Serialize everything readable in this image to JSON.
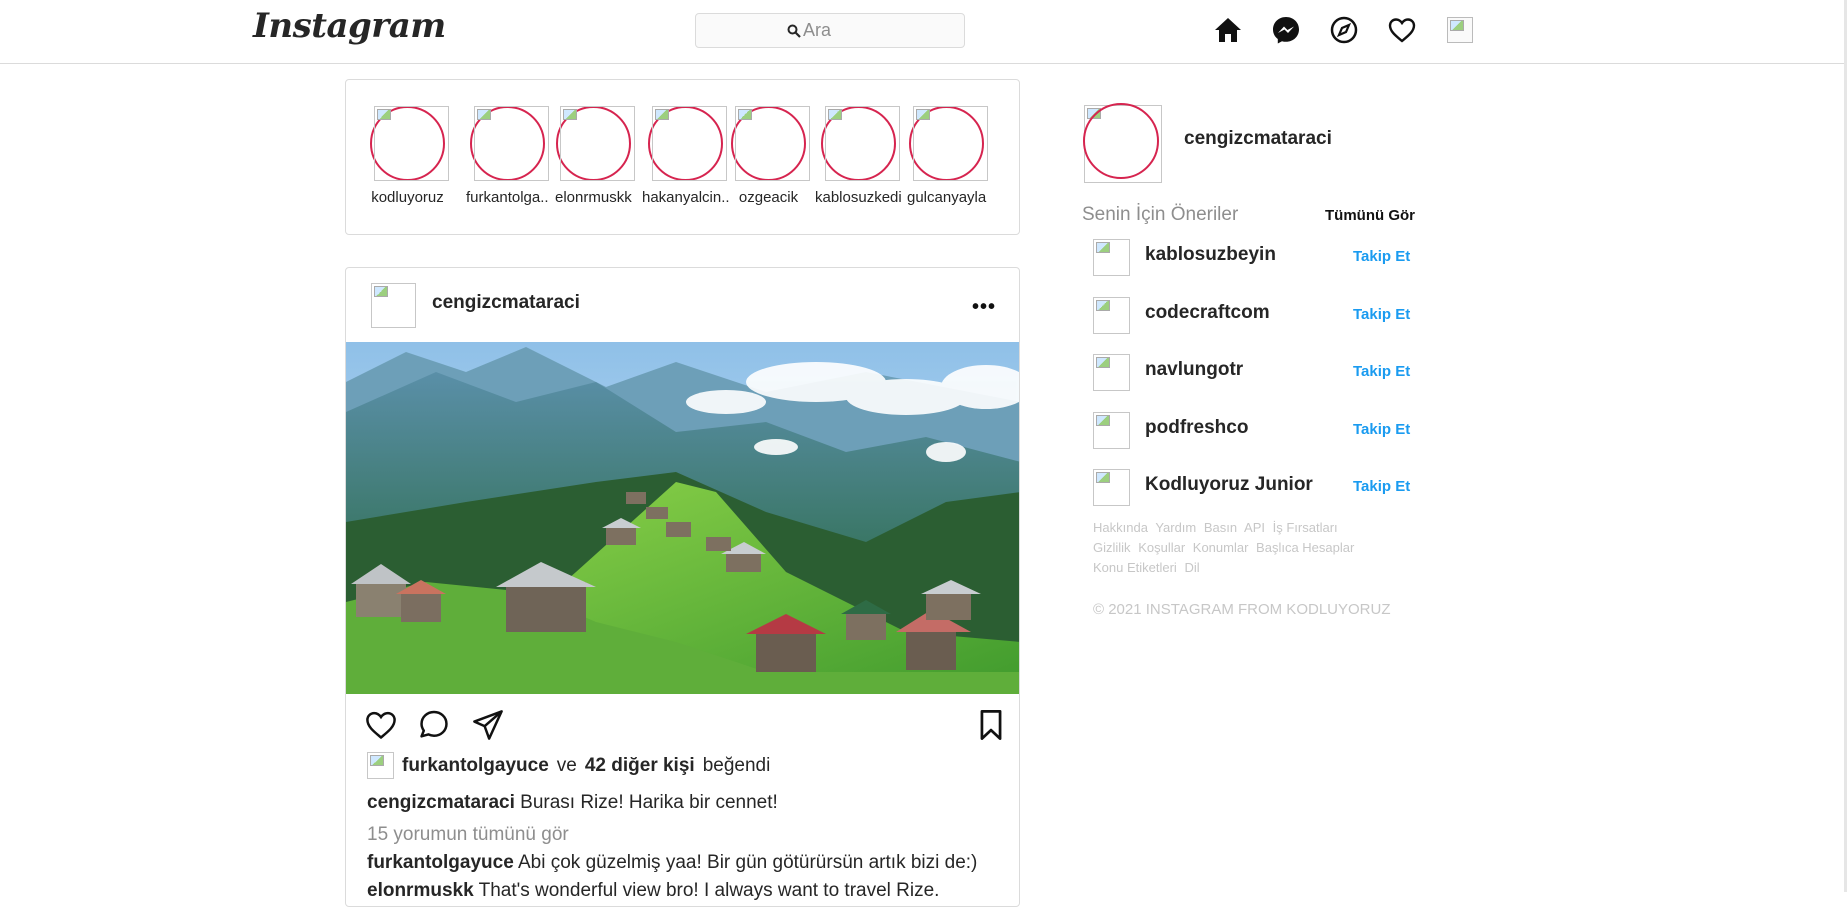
{
  "header": {
    "logo": "Instagram",
    "search_placeholder": "Ara",
    "icons": [
      "home-icon",
      "messenger-icon",
      "explore-icon",
      "heart-icon",
      "profile-avatar"
    ]
  },
  "stories": [
    {
      "username": "kodluyoruz"
    },
    {
      "username": "furkantolga.."
    },
    {
      "username": "elonrmuskk"
    },
    {
      "username": "hakanyalcin.."
    },
    {
      "username": "ozgeacik"
    },
    {
      "username": "kablosuzkedi"
    },
    {
      "username": "gulcanyayla"
    }
  ],
  "post": {
    "username": "cengizcmataraci",
    "more": "•••",
    "liked_by_user": "furkantolgayuce",
    "liked_connector": "ve",
    "liked_others": "42 diğer kişi",
    "liked_suffix": "beğendi",
    "caption_user": "cengizcmataraci",
    "caption_text": "Burası Rize! Harika bir cennet!",
    "view_comments": "15 yorumun tümünü gör",
    "comments": [
      {
        "user": "furkantolgayuce",
        "text": "Abi çok güzelmiş yaa! Bir gün götürürsün artık bizi de:)"
      },
      {
        "user": "elonrmuskk",
        "text": "That's wonderful view bro! I always want to travel Rize."
      }
    ]
  },
  "sidebar": {
    "username": "cengizcmataraci",
    "suggestions_title": "Senin İçin Öneriler",
    "see_all": "Tümünü Gör",
    "suggestions": [
      {
        "name": "kablosuzbeyin",
        "action": "Takip Et"
      },
      {
        "name": "codecraftcom",
        "action": "Takip Et"
      },
      {
        "name": "navlungotr",
        "action": "Takip Et"
      },
      {
        "name": "podfreshco",
        "action": "Takip Et"
      },
      {
        "name": "Kodluyoruz Junior",
        "action": "Takip Et"
      }
    ],
    "footer_links": [
      "Hakkında",
      "Yardım",
      "Basın",
      "API",
      "İş Fırsatları",
      "Gizlilik",
      "Koşullar",
      "Konumlar",
      "Başlıca Hesaplar",
      "Konu Etiketleri",
      "Dil"
    ],
    "copyright": "© 2021 INSTAGRAM FROM KODLUYORUZ"
  },
  "colors": {
    "story_ring": "#d6244f",
    "link_blue": "#1a9bf0",
    "border": "#dbdbdb",
    "muted": "#8e8e8e"
  }
}
